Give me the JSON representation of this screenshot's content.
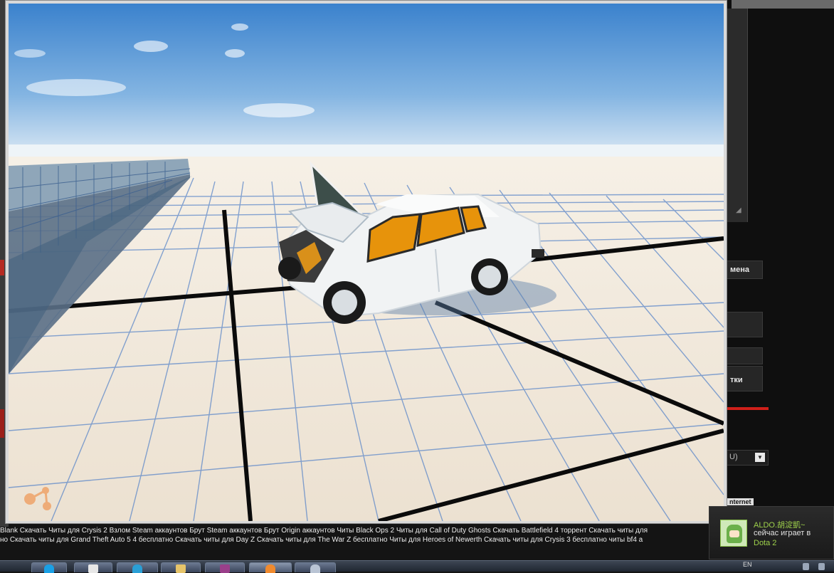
{
  "ticker": {
    "line1": "Blank Скачать Читы для Crysis 2 Взлом Steam аккаунтов Брут Steam аккаунтов Брут Origin аккаунтов Читы Black Ops 2 Читы для Call of Duty Ghosts Скачать Battlefield 4 торрент Скачать читы для",
    "line2": "но Скачать читы для Grand Theft Auto 5 4 бесплатно Скачать читы для Day Z Скачать читы для The War Z бесплатно Читы для Heroes of Newerth Скачать читы для Crysis 3 бесплатно читы bf4 a"
  },
  "background_page": {
    "label_mena": "мена",
    "label_tki": "тки",
    "select_value": "U)",
    "internet_badge": "nternet"
  },
  "notification": {
    "username": "ALDO.胡淀凱~",
    "message": "сейчас играет в",
    "game": "Dota 2"
  },
  "taskbar": {
    "language": "EN"
  },
  "colors": {
    "sky_top": "#3f86cf",
    "ground": "#efe5d6",
    "grid_line": "#5a84c8",
    "car_body": "#f2f4f5",
    "car_interior": "#e7930b",
    "steam_green": "#9ed14b",
    "accent_red": "#d0201a"
  }
}
